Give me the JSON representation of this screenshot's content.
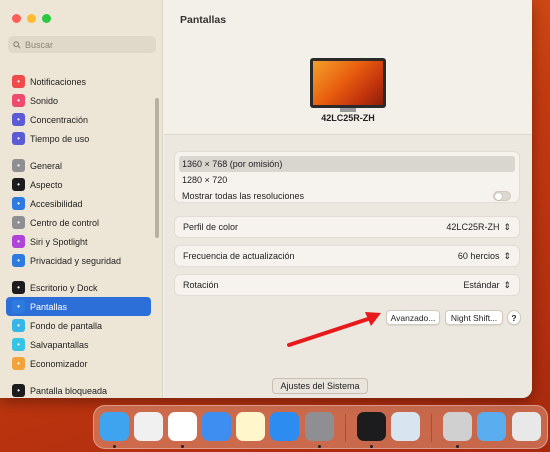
{
  "sidebar": {
    "search_placeholder": "Buscar",
    "items": [
      {
        "label": "Notificaciones",
        "icon": "bell-icon",
        "color": "#ef4b4b"
      },
      {
        "label": "Sonido",
        "icon": "speaker-icon",
        "color": "#ef4b6e"
      },
      {
        "label": "Concentración",
        "icon": "moon-icon",
        "color": "#5b5bd6"
      },
      {
        "label": "Tiempo de uso",
        "icon": "hourglass-icon",
        "color": "#5b5bd6"
      },
      {
        "label": "General",
        "icon": "gear-icon",
        "color": "#8e8e93"
      },
      {
        "label": "Aspecto",
        "icon": "appearance-icon",
        "color": "#1c1c1e"
      },
      {
        "label": "Accesibilidad",
        "icon": "accessibility-icon",
        "color": "#2d7be0"
      },
      {
        "label": "Centro de control",
        "icon": "control-center-icon",
        "color": "#8e8e93"
      },
      {
        "label": "Siri y Spotlight",
        "icon": "siri-icon",
        "color": "#b044d8"
      },
      {
        "label": "Privacidad y seguridad",
        "icon": "hand-icon",
        "color": "#2d7be0"
      },
      {
        "label": "Escritorio y Dock",
        "icon": "dock-icon",
        "color": "#1c1c1e"
      },
      {
        "label": "Pantallas",
        "icon": "sun-icon",
        "color": "#2d7be0"
      },
      {
        "label": "Fondo de pantalla",
        "icon": "wallpaper-icon",
        "color": "#35b6e6"
      },
      {
        "label": "Salvapantallas",
        "icon": "screensaver-icon",
        "color": "#35c3e6"
      },
      {
        "label": "Economizador",
        "icon": "battery-icon",
        "color": "#f2a33a"
      },
      {
        "label": "Pantalla bloqueada",
        "icon": "lock-icon",
        "color": "#1c1c1e"
      }
    ]
  },
  "main": {
    "title": "Pantallas",
    "monitor_name": "42LC25R-ZH",
    "resolutions": [
      "1360 × 768 (por omisión)",
      "1280 × 720"
    ],
    "show_all_label": "Mostrar todas las resoluciones",
    "color_profile": {
      "label": "Perfil de color",
      "value": "42LC25R-ZH"
    },
    "refresh_rate": {
      "label": "Frecuencia de actualización",
      "value": "60 hercios"
    },
    "rotation": {
      "label": "Rotación",
      "value": "Estándar"
    },
    "advanced_button": "Avanzado...",
    "night_shift_button": "Night Shift...",
    "help_button": "?"
  },
  "tooltip": "Ajustes del Sistema",
  "dock": [
    {
      "name": "finder-icon",
      "color": "#3ea4f0"
    },
    {
      "name": "launchpad-icon",
      "color": "#f0f0f0"
    },
    {
      "name": "safari-icon",
      "color": "#ffffff"
    },
    {
      "name": "mail-icon",
      "color": "#3d8ef0"
    },
    {
      "name": "notes-icon",
      "color": "#fff6cc"
    },
    {
      "name": "app-store-icon",
      "color": "#2d8cf0"
    },
    {
      "name": "system-settings-icon",
      "color": "#8e8e93"
    },
    {
      "name": "terminal-icon",
      "color": "#1c1c1e"
    },
    {
      "name": "preview-icon",
      "color": "#d8e4f0"
    },
    {
      "name": "chess-icon",
      "color": "#d0d0d0"
    },
    {
      "name": "downloads-folder-icon",
      "color": "#5aaef0"
    },
    {
      "name": "trash-icon",
      "color": "#e8e8e8"
    }
  ]
}
